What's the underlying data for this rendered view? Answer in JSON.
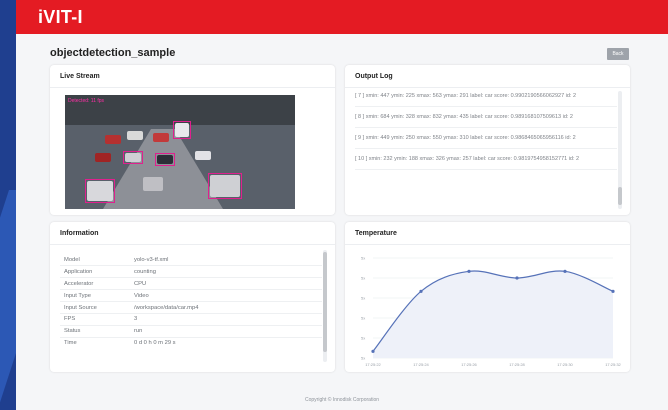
{
  "app": {
    "brand": "iVIT-I",
    "brand_color": "#e41b23"
  },
  "page": {
    "title": "objectdetection_sample",
    "back_label": "Back"
  },
  "live_stream": {
    "title": "Live Stream",
    "overlay_text": "Detected: 11 fps"
  },
  "output_log": {
    "title": "Output Log",
    "entries": [
      "[ 7 ] xmin: 447 ymin: 225 xmax: 563 ymax: 291 label: car score: 0.9902190566062927 id: 2",
      "[ 8 ] xmin: 684 ymin: 328 xmax: 832 ymax: 435 label: car score: 0.989168107509613 id: 2",
      "[ 9 ] xmin: 449 ymin: 250 xmax: 550 ymax: 310 label: car score: 0.9868465065956116 id: 2",
      "[ 10 ] xmin: 232 ymin: 188 xmax: 326 ymax: 257 label: car score: 0.9819754958152771 id: 2"
    ]
  },
  "information": {
    "title": "Information",
    "rows": [
      {
        "key": "Model",
        "value": "yolo-v3-tf.xml"
      },
      {
        "key": "Application",
        "value": "counting"
      },
      {
        "key": "Accelerator",
        "value": "CPU"
      },
      {
        "key": "Input Type",
        "value": "Video"
      },
      {
        "key": "Input Source",
        "value": "/workspace/data/car.mp4"
      },
      {
        "key": "FPS",
        "value": "3"
      },
      {
        "key": "Status",
        "value": "run"
      },
      {
        "key": "Time",
        "value": "0 d 0 h 0 m 29 s"
      }
    ]
  },
  "temperature": {
    "title": "Temperature",
    "chart_data": {
      "type": "line",
      "x": [
        "17:25:22",
        "17:25:24",
        "17:25:26",
        "17:25:28",
        "17:25:30",
        "17:25:32"
      ],
      "y_ticks": [
        "5x",
        "5x",
        "5x",
        "5x",
        "5x",
        "5x"
      ],
      "values": [
        53,
        62,
        65,
        64,
        65,
        62
      ],
      "ylim": [
        52,
        67
      ],
      "grid": true,
      "line_color": "#5672b8",
      "area_color": "#eef1f9"
    }
  },
  "footer": {
    "text": "Copyright © Innodisk Corporation"
  }
}
